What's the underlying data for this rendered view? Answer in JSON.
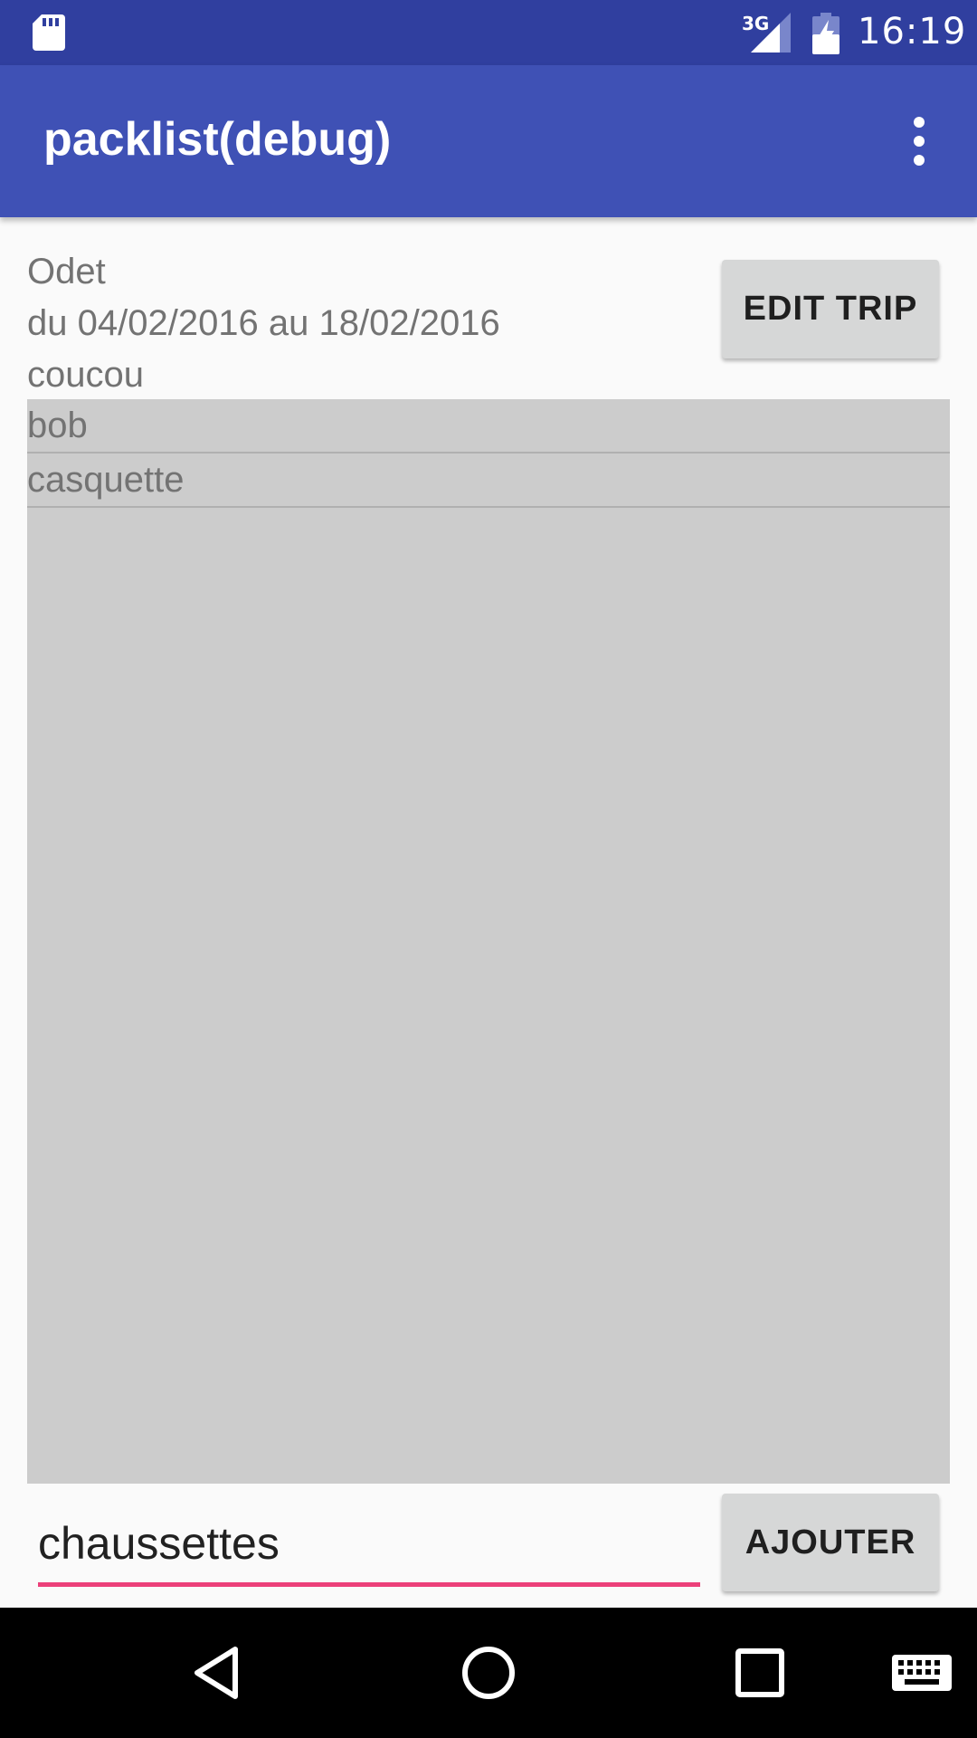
{
  "status_bar": {
    "network": "3G",
    "time": "16:19",
    "icons": [
      "sd-card-icon",
      "signal-icon",
      "battery-charging-icon"
    ]
  },
  "app_bar": {
    "title": "packlist(debug)",
    "menu_icon": "overflow-menu-icon"
  },
  "trip": {
    "name": "Odet",
    "dates": "du 04/02/2016 au 18/02/2016",
    "note": "coucou",
    "edit_label": "EDIT TRIP"
  },
  "items": [
    {
      "label": "bob"
    },
    {
      "label": "casquette"
    }
  ],
  "new_item": {
    "value": "chaussettes",
    "add_label": "AJOUTER"
  },
  "colors": {
    "status_bar": "#303f9f",
    "app_bar": "#3f51b5",
    "accent": "#ec407a",
    "list_bg": "#cccccc"
  },
  "nav_bar": {
    "icons": [
      "back-icon",
      "home-icon",
      "recents-icon",
      "keyboard-icon"
    ]
  }
}
